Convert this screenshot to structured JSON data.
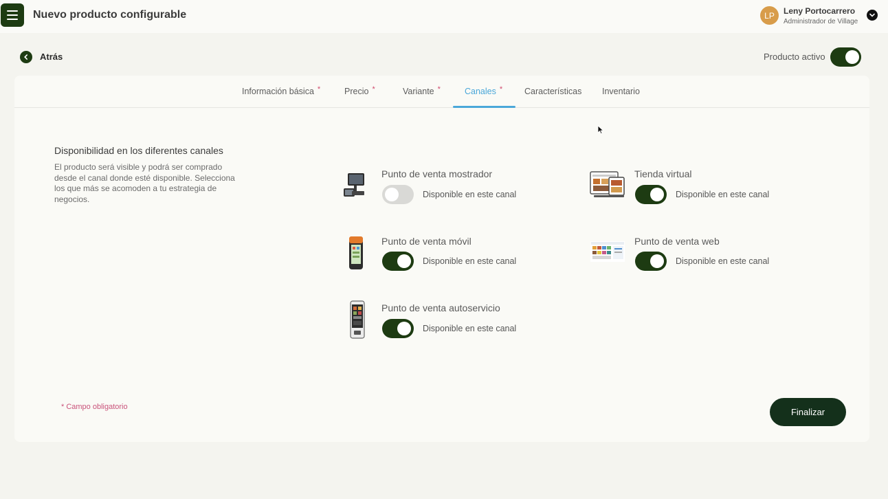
{
  "header": {
    "title": "Nuevo producto configurable",
    "user": {
      "initials": "LP",
      "name": "Leny Portocarrero",
      "role": "Administrador de Village"
    }
  },
  "toolbar": {
    "back_label": "Atrás",
    "active_label": "Producto activo",
    "active": true
  },
  "tabs": [
    {
      "label": "Información básica",
      "required": "*",
      "active": false
    },
    {
      "label": "Precio",
      "required": "*",
      "active": false
    },
    {
      "label": "Variante",
      "required": "*",
      "active": false
    },
    {
      "label": "Canales",
      "required": "*",
      "active": true
    },
    {
      "label": "Características",
      "required": "",
      "active": false
    },
    {
      "label": "Inventario",
      "required": "",
      "active": false
    }
  ],
  "section": {
    "title": "Disponibilidad en los diferentes canales",
    "description": "El producto será visible y podrá ser comprado desde el canal donde esté disponible. Selecciona los que más se acomoden a tu estrategia de negocios."
  },
  "channels": [
    {
      "name": "Punto de venta mostrador",
      "available_label": "Disponible en este canal",
      "enabled": false,
      "icon": "pos-counter-icon"
    },
    {
      "name": "Tienda virtual",
      "available_label": "Disponible en este canal",
      "enabled": true,
      "icon": "virtual-store-icon"
    },
    {
      "name": "Punto de venta móvil",
      "available_label": "Disponible en este canal",
      "enabled": true,
      "icon": "mobile-pos-icon"
    },
    {
      "name": "Punto de venta web",
      "available_label": "Disponible en este canal",
      "enabled": true,
      "icon": "web-pos-icon"
    },
    {
      "name": "Punto de venta autoservicio",
      "available_label": "Disponible en este canal",
      "enabled": true,
      "icon": "self-service-kiosk-icon"
    }
  ],
  "footer": {
    "required_note": "* Campo obligatorio",
    "finish_label": "Finalizar"
  },
  "colors": {
    "primary": "#1d3b12",
    "accent_tab": "#4aa7d9",
    "required": "#d0486c",
    "avatar": "#d89c4a"
  }
}
